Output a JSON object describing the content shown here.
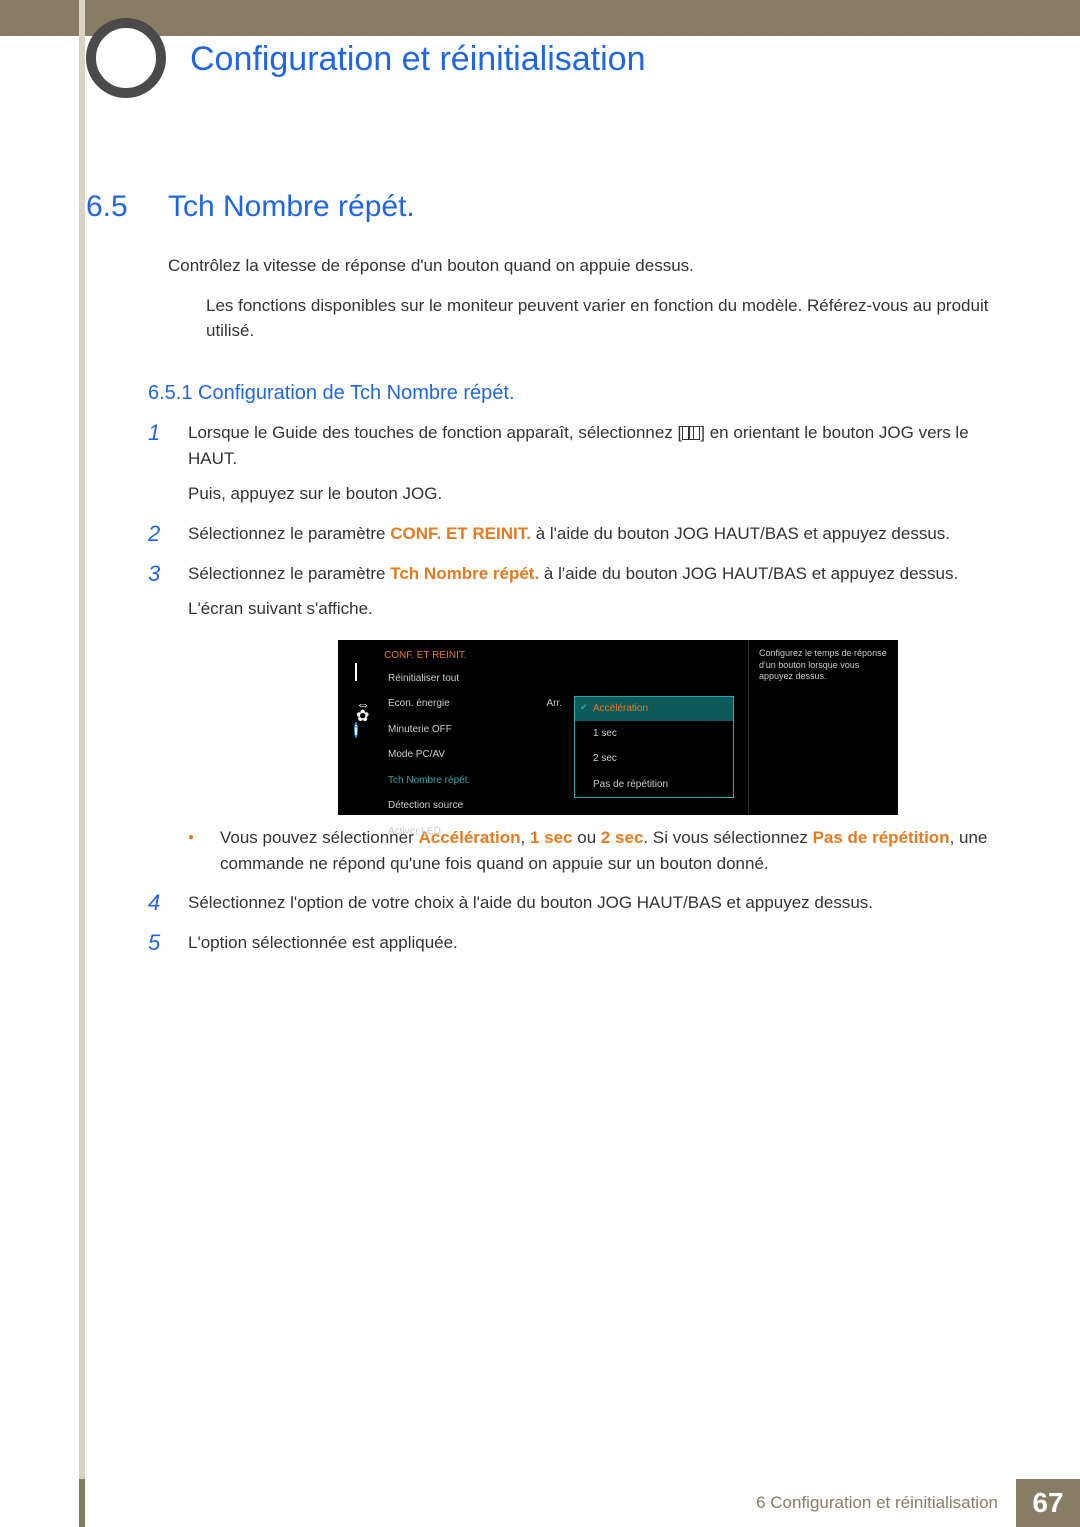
{
  "chapter_title": "Configuration et réinitialisation",
  "section": {
    "number": "6.5",
    "title": "Tch Nombre répét."
  },
  "intro": "Contrôlez la vitesse de réponse d'un bouton quand on appuie dessus.",
  "note": "Les fonctions disponibles sur le moniteur peuvent varier en fonction du modèle. Référez-vous au produit utilisé.",
  "subsection": "6.5.1   Configuration de Tch Nombre répét.",
  "steps": {
    "s1a_pre": "Lorsque le Guide des touches de fonction apparaît, sélectionnez [",
    "s1a_post": "] en orientant le bouton JOG vers le HAUT.",
    "s1b": "Puis, appuyez sur le bouton JOG.",
    "s2_pre": "Sélectionnez le paramètre ",
    "s2_hl": "CONF. ET REINIT.",
    "s2_post": " à l'aide du bouton JOG HAUT/BAS et appuyez dessus.",
    "s3_pre": "Sélectionnez le paramètre ",
    "s3_hl": "Tch Nombre répét.",
    "s3_post": " à l'aide du bouton JOG HAUT/BAS et appuyez dessus.",
    "s3b": "L'écran suivant s'affiche.",
    "bullet_pre": "Vous pouvez sélectionner ",
    "bullet_h1": "Accélération",
    "bullet_mid1": ", ",
    "bullet_h2": "1 sec",
    "bullet_mid2": " ou ",
    "bullet_h3": "2 sec",
    "bullet_mid3": ". Si vous sélectionnez ",
    "bullet_h4": "Pas de répétition",
    "bullet_post": ", une commande ne répond qu'une fois quand on appuie sur un bouton donné.",
    "s4": "Sélectionnez l'option de votre choix à l'aide du bouton JOG HAUT/BAS et appuyez dessus.",
    "s5": "L'option sélectionnée est appliquée."
  },
  "step_numbers": {
    "n1": "1",
    "n2": "2",
    "n3": "3",
    "n4": "4",
    "n5": "5"
  },
  "osd": {
    "title": "CONF. ET REINIT.",
    "items": [
      {
        "label": "Réinitialiser tout",
        "value": ""
      },
      {
        "label": "Econ. énergie",
        "value": "Arr."
      },
      {
        "label": "Minuterie OFF",
        "value": ""
      },
      {
        "label": "Mode PC/AV",
        "value": ""
      },
      {
        "label": "Tch Nombre répét.",
        "value": ""
      },
      {
        "label": "Détection source",
        "value": ""
      },
      {
        "label": "Activer LED",
        "value": ""
      }
    ],
    "popup": [
      "Accélération",
      "1 sec",
      "2 sec",
      "Pas de répétition"
    ],
    "help": "Configurez le temps de réponse d'un bouton lorsque vous appuyez dessus."
  },
  "footer": {
    "label": "6 Configuration et réinitialisation",
    "page": "67"
  }
}
